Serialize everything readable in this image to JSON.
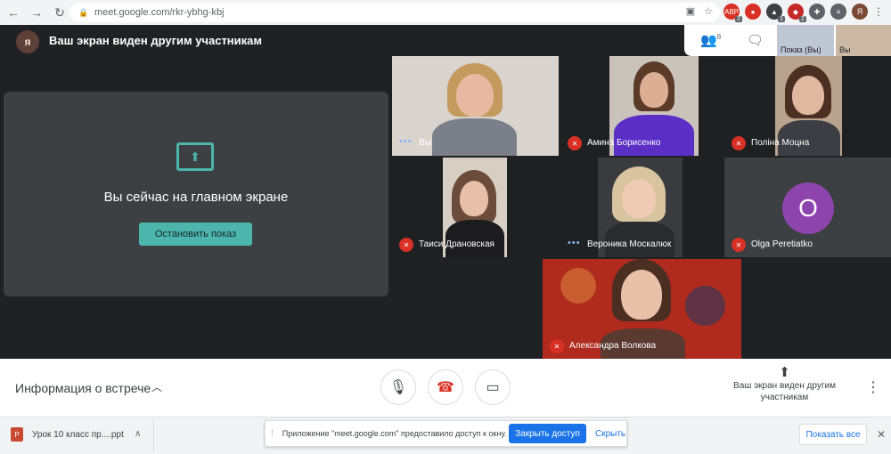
{
  "browser": {
    "url": "meet.google.com/rkr-ybhg-kbj",
    "profile_initial": "Я",
    "extensions": [
      {
        "name": "ext-abp",
        "badge": "2",
        "color": "#d93025"
      },
      {
        "name": "ext-red",
        "badge": "",
        "color": "#d93025"
      },
      {
        "name": "ext-blue",
        "badge": "1",
        "color": "#3c4043"
      },
      {
        "name": "ext-dark",
        "badge": "2",
        "color": "#c62828"
      }
    ]
  },
  "header": {
    "avatar_initial": "я",
    "title": "Ваш экран виден другим участникам",
    "people_count": "8",
    "thumb_self_label": "Показ (Вы)",
    "thumb_other_label": "Вы"
  },
  "presentation": {
    "message": "Вы сейчас на главном экране",
    "stop_label": "Остановить показ"
  },
  "participants": [
    {
      "name": "Вы",
      "muted": false
    },
    {
      "name": "Амина Борисенко",
      "muted": true
    },
    {
      "name": "Поліна Моцна",
      "muted": true
    },
    {
      "name": "Таиси Драновская",
      "muted": true
    },
    {
      "name": "Вероника Москалюк",
      "muted": false
    },
    {
      "name": "Olga Peretiatko",
      "muted": true,
      "initial": "O"
    },
    {
      "name": "Александра Волкова",
      "muted": true
    }
  ],
  "toolbar": {
    "meeting_info": "Информация о встрече",
    "presenting_label": "Ваш экран виден другим участникам"
  },
  "downloads": {
    "file_name": "Урок 10 класс пр....ppt"
  },
  "infobar": {
    "message": "Приложение \"meet.google.com\" предоставило доступ к окну.",
    "stop_access": "Закрыть доступ",
    "hide": "Скрыть"
  },
  "shelf": {
    "show_all": "Показать все"
  },
  "colors": {
    "accent": "#4db6ac",
    "mute_red": "#d93025",
    "meet_bg": "#202124"
  }
}
